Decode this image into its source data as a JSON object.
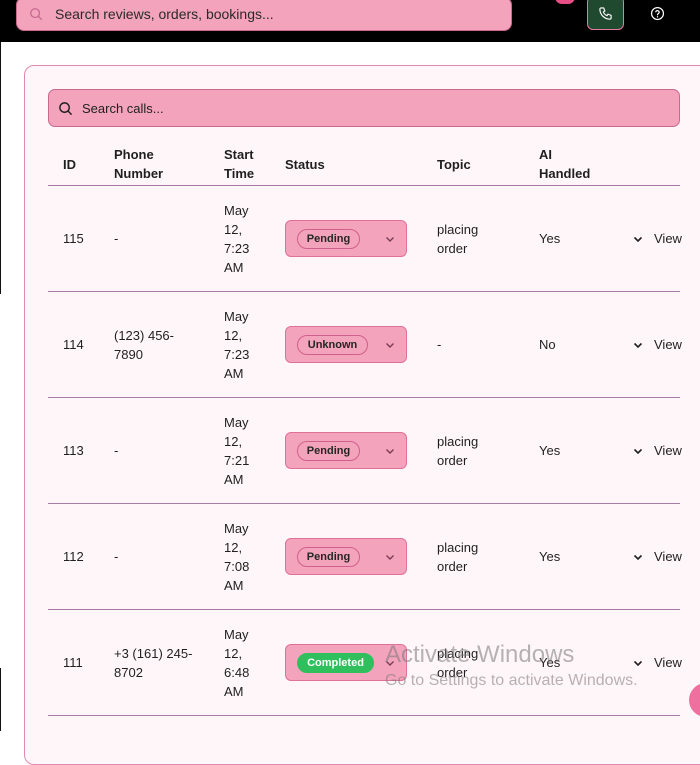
{
  "topbar": {
    "search_placeholder": "Search reviews, orders, bookings...",
    "icons": [
      "search-icon",
      "phone-icon",
      "help-icon"
    ]
  },
  "calls": {
    "search_placeholder": "Search calls...",
    "columns": {
      "id": "ID",
      "phone_1": "Phone",
      "phone_2": "Number",
      "start_1": "Start",
      "start_2": "Time",
      "status": "Status",
      "topic": "Topic",
      "ai_1": "AI",
      "ai_2": "Handled"
    },
    "view_label": "View",
    "rows": [
      {
        "id": "115",
        "phone": [
          "-"
        ],
        "start": [
          "May",
          "12,",
          "7:23",
          "AM"
        ],
        "status": "Pending",
        "topic": [
          "placing",
          "order"
        ],
        "ai": "Yes"
      },
      {
        "id": "114",
        "phone": [
          "(123) 456-",
          "7890"
        ],
        "start": [
          "May",
          "12,",
          "7:23",
          "AM"
        ],
        "status": "Unknown",
        "topic": [
          "-"
        ],
        "ai": "No"
      },
      {
        "id": "113",
        "phone": [
          "-"
        ],
        "start": [
          "May",
          "12,",
          "7:21",
          "AM"
        ],
        "status": "Pending",
        "topic": [
          "placing",
          "order"
        ],
        "ai": "Yes"
      },
      {
        "id": "112",
        "phone": [
          "-"
        ],
        "start": [
          "May",
          "12,",
          "7:08",
          "AM"
        ],
        "status": "Pending",
        "topic": [
          "placing",
          "order"
        ],
        "ai": "Yes"
      },
      {
        "id": "111",
        "phone": [
          "+3 (161) 245-",
          "8702"
        ],
        "start": [
          "May",
          "12,",
          "6:48",
          "AM"
        ],
        "status": "Completed",
        "topic": [
          "placing",
          "order"
        ],
        "ai": "Yes"
      }
    ]
  },
  "watermark": {
    "title": "Activate Windows",
    "subtitle": "Go to Settings to activate Windows."
  },
  "colors": {
    "accent_pink": "#f4a3bd",
    "completed_green": "#2fbf5c",
    "phone_button": "#1f4a2f"
  }
}
